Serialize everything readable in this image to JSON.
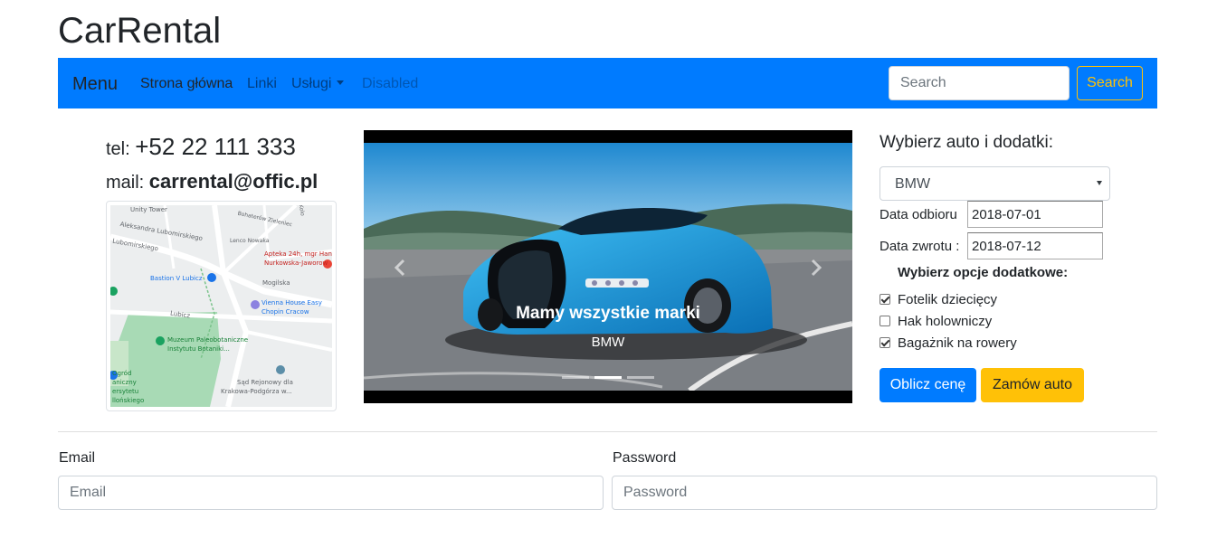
{
  "brand": {
    "title": "CarRental"
  },
  "navbar": {
    "menu_label": "Menu",
    "links": {
      "home": "Strona główna",
      "links": "Linki",
      "services": "Usługi",
      "disabled": "Disabled"
    },
    "search_placeholder": "Search",
    "search_button": "Search",
    "accent_color": "#007bff",
    "search_button_color": "#ffc107"
  },
  "contact": {
    "tel_label": "tel:",
    "tel_value": "+52 22 111 333",
    "mail_label": "mail:",
    "mail_value": "carrental@offic.pl"
  },
  "map": {
    "labels": {
      "unity_tower": "Unity Tower",
      "lubomirskiego1": "Aleksandra Lubomirskiego",
      "lubomirskiego2": "Lubomirskiego",
      "bohaterow": "Bohaterów Zieleniec",
      "kopernika": "Lenco Nowaka",
      "apteka1": "Apteka 24h, mgr Han",
      "apteka2": "Nurkowska-Jaworow",
      "mogilska": "Mogilska",
      "bastion": "Bastion V Lubicz",
      "vienna1": "Vienna House Easy",
      "vienna2": "Chopin Cracow",
      "lubicz": "Lubicz",
      "muzeum1": "Muzeum Paleobotaniczne",
      "muzeum2": "Instytutu Botaniki...",
      "ogrod1": "Ogród",
      "ogrod2": "aniczny",
      "ogrod3": "ersytetu",
      "ogrod4": "llońskiego",
      "sad1": "Sąd Rejonowy dla",
      "sad2": "Krakowa-Podgórza w...",
      "kolo": "Kolo"
    }
  },
  "carousel": {
    "caption_title": "Mamy wszystkie marki",
    "caption_subtitle": "BMW",
    "slides_count": 3,
    "active_slide": 2
  },
  "order": {
    "heading": "Wybierz auto i dodatki:",
    "car_selected": "BMW",
    "pickup_label": "Data odbioru",
    "pickup_value": "2018-07-01",
    "return_label": "Data zwrotu :",
    "return_value": "2018-07-12",
    "options_heading": "Wybierz opcje dodatkowe:",
    "options": [
      {
        "label": "Fotelik dziecięcy",
        "checked": true
      },
      {
        "label": "Hak holowniczy",
        "checked": false
      },
      {
        "label": "Bagażnik na rowery",
        "checked": true
      }
    ],
    "calc_button": "Oblicz cenę",
    "order_button": "Zamów auto"
  },
  "login": {
    "email_label": "Email",
    "email_placeholder": "Email",
    "password_label": "Password",
    "password_placeholder": "Password"
  }
}
